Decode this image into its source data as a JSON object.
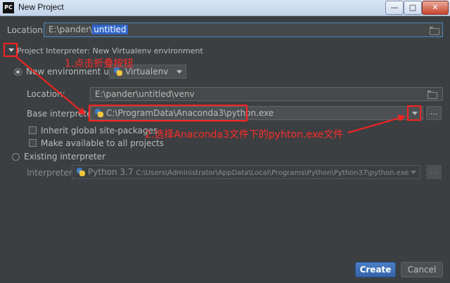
{
  "window": {
    "title": "New Project",
    "app_icon": "PC",
    "min_label": "—",
    "max_label": "□",
    "close_label": "✕"
  },
  "location": {
    "label": "Location:",
    "value_prefix": "E:\\pander\\",
    "value_selected": "untitled"
  },
  "section": {
    "label": "Project Interpreter: New Virtualenv environment"
  },
  "new_env": {
    "label": "New environment using",
    "tool": "Virtualenv",
    "location_label": "Location:",
    "location_value": "E:\\pander\\untitled\\venv",
    "base_label": "Base interpreter:",
    "base_value": "C:\\ProgramData\\Anaconda3\\python.exe",
    "browse_label": "...",
    "inherit_label": "Inherit global site-packages",
    "available_label": "Make available to all projects"
  },
  "existing": {
    "label": "Existing interpreter",
    "interpreter_label": "Interpreter:",
    "version": "Python 3.7",
    "path": "C:\\Users\\Administrator\\AppData\\Local\\Programs\\Python\\Python37\\python.exe",
    "browse_label": "..."
  },
  "annotations": {
    "step1": "1.点击折叠按钮",
    "step2": "2.选择Anaconda3文件下的pyhton.exe文件"
  },
  "buttons": {
    "create": "Create",
    "cancel": "Cancel"
  },
  "colors": {
    "background": "#3c3f41",
    "field": "#45494a",
    "selection": "#2f65ca",
    "annotation": "#ff2a2a",
    "primary_button": "#3d6fb5"
  }
}
